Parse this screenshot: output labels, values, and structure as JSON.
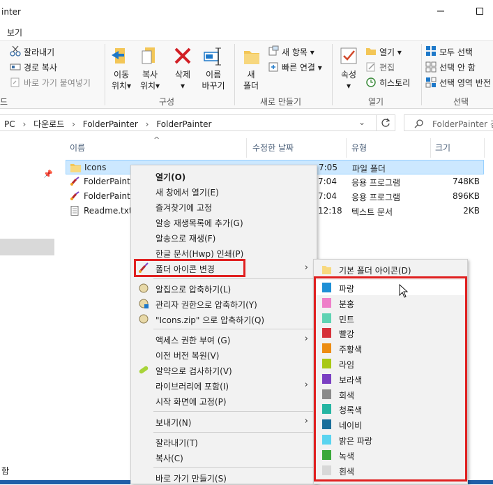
{
  "window": {
    "title": "inter"
  },
  "tabs": {
    "view": "보기"
  },
  "ribbon": {
    "clipboard": {
      "cut": "잘라내기",
      "copy_path": "경로 복사",
      "paste_shortcut": "바로 가기 붙여넣기",
      "caption": "드"
    },
    "organize": {
      "move_to": [
        "이동",
        "위치"
      ],
      "copy_to": [
        "복사",
        "위치"
      ],
      "delete": "삭제",
      "rename": [
        "이름",
        "바꾸기"
      ],
      "caption": "구성"
    },
    "new": {
      "new_folder": [
        "새",
        "폴더"
      ],
      "new_item": "새 항목",
      "easy_access": "빠른 연결",
      "caption": "새로 만들기"
    },
    "open": {
      "properties": "속성",
      "open": "열기",
      "edit": "편집",
      "history": "히스토리",
      "caption": "열기"
    },
    "select": {
      "select_all": "모두 선택",
      "select_none": "선택 안 함",
      "invert": "선택 영역 반전",
      "caption": "선택"
    }
  },
  "address": {
    "path": [
      "PC",
      "다운로드",
      "FolderPainter",
      "FolderPainter"
    ],
    "search_placeholder": "FolderPainter 검"
  },
  "columns": {
    "name": "이름",
    "modified": "수정한 날짜",
    "type": "유형",
    "size": "크기"
  },
  "files": [
    {
      "name": "Icons",
      "date": "7:05",
      "type": "파일 폴더",
      "size": "",
      "icon": "folder-icon"
    },
    {
      "name": "FolderPainte",
      "date": "7:04",
      "type": "응용 프로그램",
      "size": "748KB",
      "icon": "app-icon"
    },
    {
      "name": "FolderPainte",
      "date": "7:04",
      "type": "응용 프로그램",
      "size": "896KB",
      "icon": "app-icon"
    },
    {
      "name": "Readme.txt",
      "date": "12:18",
      "type": "텍스트 문서",
      "size": "2KB",
      "icon": "text-file-icon"
    }
  ],
  "status": {
    "text": "함"
  },
  "context_menu": {
    "items": [
      {
        "label": "열기(O)",
        "bold": true
      },
      {
        "label": "새 창에서 열기(E)"
      },
      {
        "label": "즐겨찾기에 고정"
      },
      {
        "label": "알송 재생목록에 추가(G)"
      },
      {
        "label": "알송으로 재생(F)"
      },
      {
        "label": "한글 문서(Hwp) 인쇄(P)"
      },
      {
        "label": "폴더 아이콘 변경",
        "submenu": true,
        "highlight": true
      },
      {
        "label": "알집으로 압축하기(L)"
      },
      {
        "label": "관리자 권한으로 압축하기(Y)"
      },
      {
        "label": "\"Icons.zip\" 으로 압축하기(Q)"
      },
      {
        "label": "액세스 권한 부여 (G)",
        "submenu": true
      },
      {
        "label": "이전 버전 복원(V)"
      },
      {
        "label": "알약으로 검사하기(V)"
      },
      {
        "label": "라이브러리에 포함(I)",
        "submenu": true
      },
      {
        "label": "시작 화면에 고정(P)"
      },
      {
        "label": "보내기(N)",
        "submenu": true
      },
      {
        "label": "잘라내기(T)"
      },
      {
        "label": "복사(C)"
      },
      {
        "label": "바로 가기 만들기(S)"
      }
    ]
  },
  "submenu": {
    "default_label": "기본 폴더 아이콘(D)",
    "colors": [
      {
        "label": "파랑",
        "color": "#1e8fd6"
      },
      {
        "label": "분홍",
        "color": "#ee7fc9"
      },
      {
        "label": "민트",
        "color": "#5fd3b3"
      },
      {
        "label": "빨강",
        "color": "#d6313a"
      },
      {
        "label": "주황색",
        "color": "#ec8c12"
      },
      {
        "label": "라임",
        "color": "#a8c814"
      },
      {
        "label": "보라색",
        "color": "#7a3fc2"
      },
      {
        "label": "회색",
        "color": "#8a8a8a"
      },
      {
        "label": "청록색",
        "color": "#25b5a2"
      },
      {
        "label": "네이비",
        "color": "#1a6f9a"
      },
      {
        "label": "밝은 파랑",
        "color": "#5ad4f0"
      },
      {
        "label": "녹색",
        "color": "#3aa83a"
      },
      {
        "label": "흰색",
        "color": "#d8d8d8"
      }
    ]
  }
}
